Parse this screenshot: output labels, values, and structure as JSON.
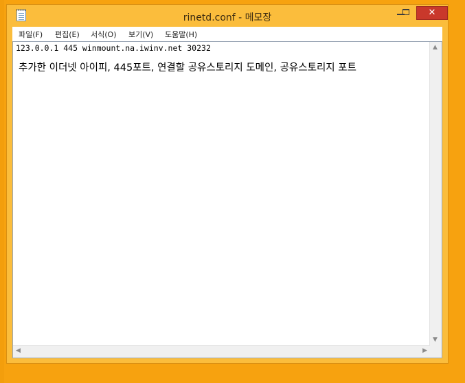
{
  "window": {
    "title": "rinetd.conf - 메모장",
    "close_glyph": "✕"
  },
  "menu": {
    "items": [
      {
        "label": "파일(F)"
      },
      {
        "label": "편집(E)"
      },
      {
        "label": "서식(O)"
      },
      {
        "label": "보기(V)"
      },
      {
        "label": "도움말(H)"
      }
    ]
  },
  "editor": {
    "line1": "123.0.0.1 445 winmount.na.iwinv.net 30232",
    "line2": "추가한 이더넷 아이피, 445포트, 연결할 공유스토리지 도메인, 공유스토리지 포트"
  },
  "scroll": {
    "up": "▲",
    "down": "▼",
    "left": "◀",
    "right": "▶"
  },
  "colors": {
    "desktop": "#f7a20f",
    "window_frame": "#fbbd3c",
    "close_button": "#c9382b"
  }
}
